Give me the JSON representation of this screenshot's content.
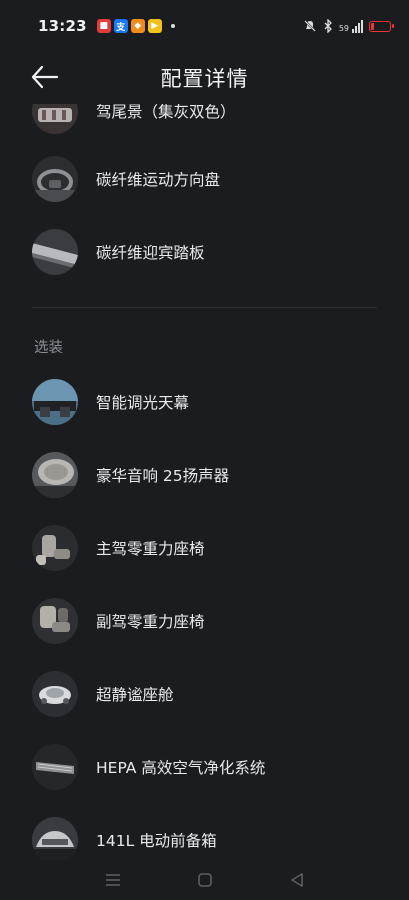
{
  "status_bar": {
    "time": "13:23",
    "app_icons": [
      {
        "name": "app-red-icon",
        "color": "#e23b3b",
        "glyph": "■"
      },
      {
        "name": "alipay-icon",
        "color": "#1677ff",
        "glyph": "支"
      },
      {
        "name": "app-orange-icon",
        "color": "#f28a1c",
        "glyph": "◆"
      },
      {
        "name": "app-multi-icon",
        "color": "#f3c21a",
        "glyph": "▶"
      }
    ],
    "network_speed": "59",
    "battery_color": "#e33b3b"
  },
  "header": {
    "title": "配置详情"
  },
  "standard_items": [
    {
      "label": "驾尾景（集灰双色）",
      "icon": "vehicle-rear-icon"
    },
    {
      "label": "碳纤维运动方向盘",
      "icon": "steering-wheel-icon"
    },
    {
      "label": "碳纤维迎宾踏板",
      "icon": "door-sill-icon"
    }
  ],
  "optional_section": {
    "title": "选装"
  },
  "optional_items": [
    {
      "label": "智能调光天幕",
      "icon": "sunroof-icon"
    },
    {
      "label": "豪华音响 25扬声器",
      "icon": "speaker-icon"
    },
    {
      "label": "主驾零重力座椅",
      "icon": "driver-seat-icon"
    },
    {
      "label": "副驾零重力座椅",
      "icon": "passenger-seat-icon"
    },
    {
      "label": "超静谧座舱",
      "icon": "quiet-cabin-icon"
    },
    {
      "label": "HEPA 高效空气净化系统",
      "icon": "air-filter-icon"
    },
    {
      "label": "141L 电动前备箱",
      "icon": "front-trunk-icon"
    }
  ]
}
